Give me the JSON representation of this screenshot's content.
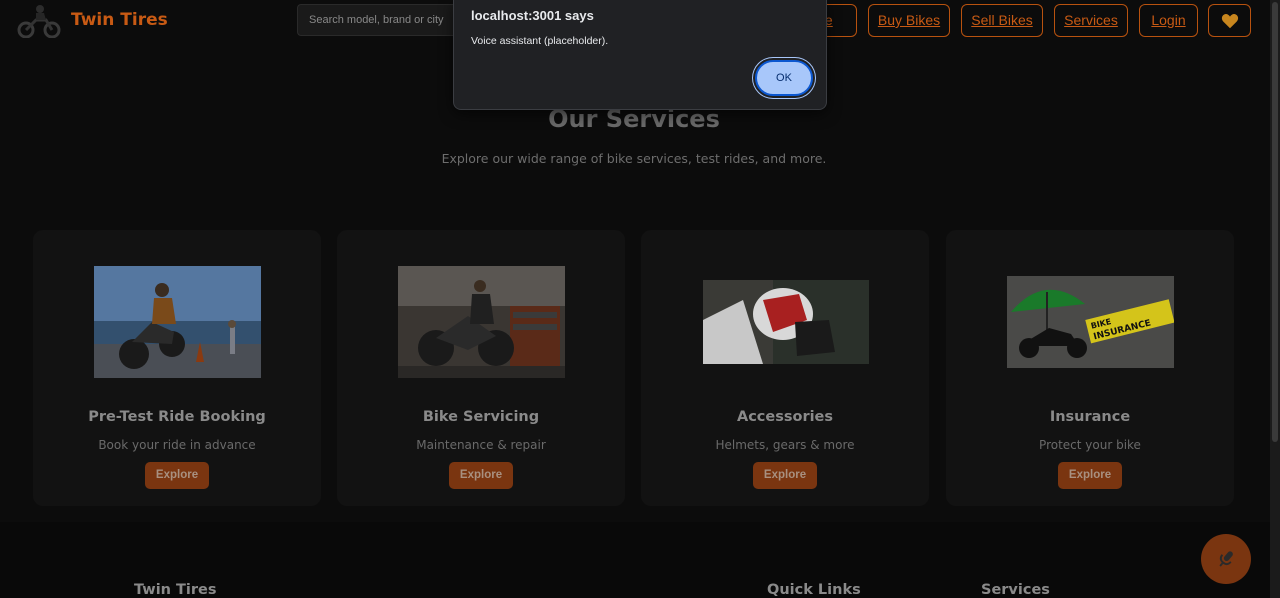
{
  "header": {
    "brand": "Twin Tires",
    "search_placeholder": "Search model, brand or city",
    "nav": {
      "home": "me",
      "buy": "Buy Bikes",
      "sell": "Sell Bikes",
      "services": "Services",
      "login": "Login"
    },
    "heart_icon": "heart-icon"
  },
  "hero": {
    "title": "Our Services",
    "subtitle": "Explore our wide range of bike services, test rides, and more."
  },
  "cards": [
    {
      "title": "Pre-Test Ride Booking",
      "subtitle": "Book your ride in advance",
      "button": "Explore"
    },
    {
      "title": "Bike Servicing",
      "subtitle": "Maintenance & repair",
      "button": "Explore"
    },
    {
      "title": "Accessories",
      "subtitle": "Helmets, gears & more",
      "button": "Explore"
    },
    {
      "title": "Insurance",
      "subtitle": "Protect your bike",
      "button": "Explore"
    }
  ],
  "insurance_sign": {
    "line1": "BIKE",
    "line2": "INSURANCE"
  },
  "footer": {
    "col1": "Twin Tires",
    "col2": "Quick Links",
    "col3": "Services"
  },
  "dialog": {
    "title": "localhost:3001 says",
    "message": "Voice assistant (placeholder).",
    "ok": "OK"
  },
  "colors": {
    "accent": "#c85a14",
    "dialog_bg": "#202124",
    "ok_button": "#a8c7fa"
  }
}
